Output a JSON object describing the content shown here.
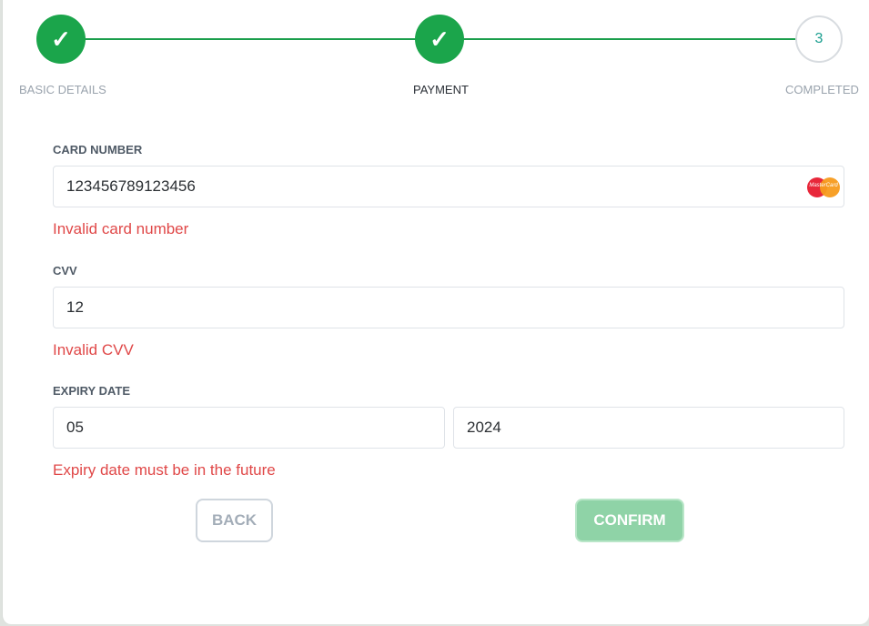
{
  "stepper": {
    "steps": [
      {
        "label": "BASIC DETAILS",
        "status": "done",
        "icon": "checkmark-icon",
        "glyph": "✓"
      },
      {
        "label": "PAYMENT",
        "status": "done",
        "icon": "checkmark-icon",
        "glyph": "✓"
      },
      {
        "label": "COMPLETED",
        "status": "pending",
        "number": "3"
      }
    ],
    "accent": "#1ba54b"
  },
  "form": {
    "card_number": {
      "label": "CARD NUMBER",
      "value": "123456789123456",
      "error": "Invalid card number",
      "brand_icon": "mastercard-icon",
      "brand_text": "MasterCard"
    },
    "cvv": {
      "label": "CVV",
      "value": "12",
      "error": "Invalid CVV"
    },
    "expiry": {
      "label": "EXPIRY DATE",
      "month": "05",
      "year": "2024",
      "error": "Expiry date must be in the future"
    }
  },
  "actions": {
    "back_label": "BACK",
    "confirm_label": "CONFIRM"
  },
  "colors": {
    "error": "#e04848",
    "confirm_disabled": "#8fd3a7"
  }
}
